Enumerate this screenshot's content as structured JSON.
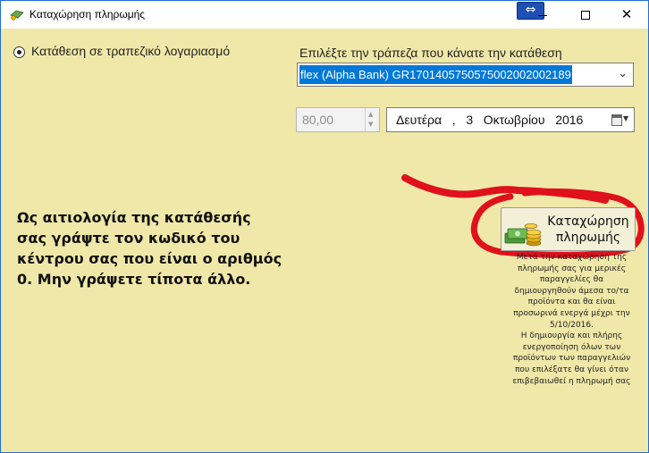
{
  "window": {
    "title": "Καταχώρηση πληρωμής",
    "resize_icon": "⇔",
    "close_glyph": "✕"
  },
  "payment_method": {
    "selected": true,
    "label": "Κατάθεση σε τραπεζικό λογαριασμό"
  },
  "bank": {
    "label": "Επιλέξτε την τράπεζα που κάνατε την κατάθεση",
    "selected_value": "flex (Alpha Bank)  GR1701405750575002002002189",
    "chevron": "⌄"
  },
  "amount": {
    "value": "80,00",
    "enabled": false
  },
  "date": {
    "weekday": "Δευτέρα",
    "separator": ",",
    "day": "3",
    "month": "Οκτωβρίου",
    "year": "2016"
  },
  "instructions": {
    "text": "Ως αιτιολογία της κατάθεσής σας γράψτε τον κωδικό του κέντρου σας που είναι ο αριθμός 0. Μην γράψετε τίποτα άλλο."
  },
  "submit": {
    "line1": "Καταχώρηση",
    "line2": "πληρωμής",
    "icon": "money-stack-icon"
  },
  "note": {
    "lines": [
      "Μετά την καταχώρηση της",
      "πληρωμής σας για μερικές",
      "παραγγελίες θα",
      "δημιουργηθούν άμεσα το/τα",
      "προϊόντα και θα είναι",
      "προσωρινά ενεργά μέχρι την",
      "5/10/2016.",
      "Η δημιουργία και πλήρης",
      "ενεργοποίηση όλων των",
      "προϊόντων των παραγγελιών",
      "που επιλέξατε θα γίνει όταν",
      "επιβεβαιωθεί η πληρωμή σας"
    ]
  },
  "colors": {
    "background": "#f0e8a8",
    "selection": "#0078d7",
    "annotation": "#e0101c"
  }
}
